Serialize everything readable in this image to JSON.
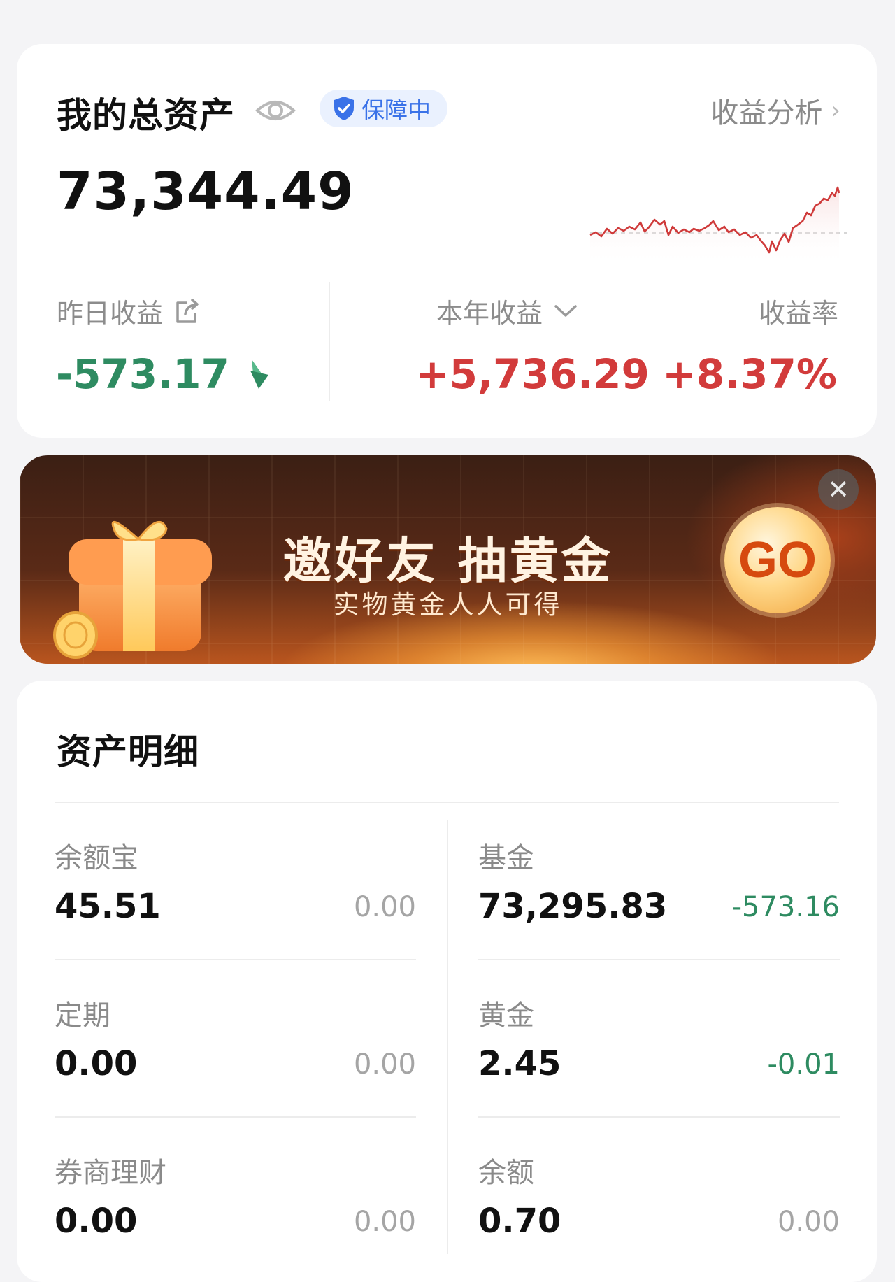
{
  "summary": {
    "title": "我的总资产",
    "badge": "保障中",
    "analysis_link": "收益分析",
    "total": "73,344.49",
    "yesterday_label": "昨日收益",
    "yesterday_value": "-573.17",
    "year_label": "本年收益",
    "year_value": "+5,736.29",
    "rate_label": "收益率",
    "rate_value": "+8.37%"
  },
  "banner": {
    "title": "邀好友 抽黄金",
    "subtitle": "实物黄金人人可得",
    "go": "GO"
  },
  "details": {
    "title": "资产明细",
    "items": [
      {
        "name": "余额宝",
        "amount": "45.51",
        "change": "0.00",
        "trend": "flat"
      },
      {
        "name": "基金",
        "amount": "73,295.83",
        "change": "-573.16",
        "trend": "down"
      },
      {
        "name": "定期",
        "amount": "0.00",
        "change": "0.00",
        "trend": "flat"
      },
      {
        "name": "黄金",
        "amount": "2.45",
        "change": "-0.01",
        "trend": "down"
      },
      {
        "name": "券商理财",
        "amount": "0.00",
        "change": "0.00",
        "trend": "flat"
      },
      {
        "name": "余额",
        "amount": "0.70",
        "change": "0.00",
        "trend": "flat"
      }
    ]
  },
  "colors": {
    "gain": "#d23b3b",
    "loss": "#2e8b61",
    "neutral": "#a5a5a5",
    "accent": "#3a72e8"
  },
  "icons": [
    "eye-icon",
    "shield-check-icon",
    "chevron-right-icon",
    "share-icon",
    "down-arrow-icon",
    "chevron-down-icon",
    "gift-icon",
    "close-icon"
  ]
}
